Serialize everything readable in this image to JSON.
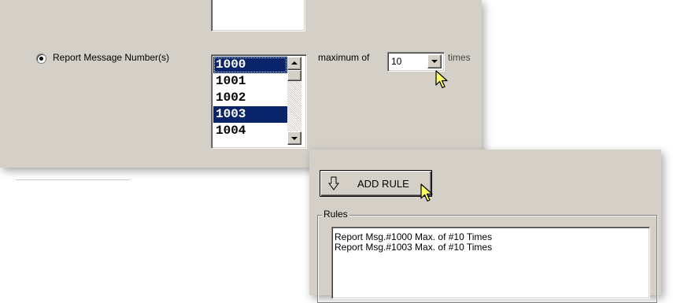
{
  "report_option": {
    "label": "Report Message Number(s)",
    "selected": true
  },
  "message_list": {
    "items": [
      {
        "value": "1000",
        "selected": true
      },
      {
        "value": "1001",
        "selected": false
      },
      {
        "value": "1002",
        "selected": false
      },
      {
        "value": "1003",
        "selected": true
      },
      {
        "value": "1004",
        "selected": false
      }
    ]
  },
  "maximum": {
    "prefix_label": "maximum of",
    "value": "10",
    "suffix_label": "times"
  },
  "add_rule_button": {
    "label": "ADD RULE"
  },
  "rules": {
    "group_label": "Rules",
    "lines": [
      "Report Msg.#1000 Max. of #10 Times",
      "Report Msg.#1003 Max. of #10 Times"
    ]
  },
  "colors": {
    "panel": "#d4d0c8",
    "selection": "#0a246a",
    "cursor": "#ffff66"
  }
}
